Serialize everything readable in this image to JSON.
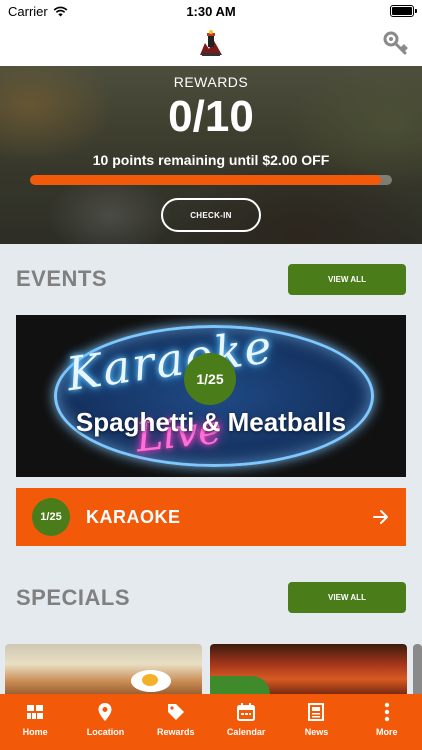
{
  "status_bar": {
    "carrier": "Carrier",
    "time": "1:30 AM"
  },
  "rewards": {
    "label": "REWARDS",
    "count": "0/10",
    "remaining_text": "10 points remaining until $2.00 OFF",
    "progress_fraction": 0.97,
    "checkin_label": "CHECK-IN"
  },
  "events": {
    "title": "EVENTS",
    "view_all_label": "VIEW ALL",
    "featured": {
      "badge": "1/25",
      "title": "Spaghetti & Meatballs",
      "neon_top": "Karaoke",
      "neon_bottom": "Live"
    },
    "list": [
      {
        "badge": "1/25",
        "label": "KARAOKE"
      }
    ]
  },
  "specials": {
    "title": "SPECIALS",
    "view_all_label": "VIEW ALL"
  },
  "tabs": [
    {
      "label": "Home",
      "icon": "home-grid-icon"
    },
    {
      "label": "Location",
      "icon": "map-pin-icon"
    },
    {
      "label": "Rewards",
      "icon": "tag-icon"
    },
    {
      "label": "Calendar",
      "icon": "calendar-icon"
    },
    {
      "label": "News",
      "icon": "news-icon"
    },
    {
      "label": "More",
      "icon": "more-vertical-icon"
    }
  ],
  "colors": {
    "accent": "#f25a0a",
    "green": "#4a7c1a",
    "background": "#e4eaee"
  }
}
